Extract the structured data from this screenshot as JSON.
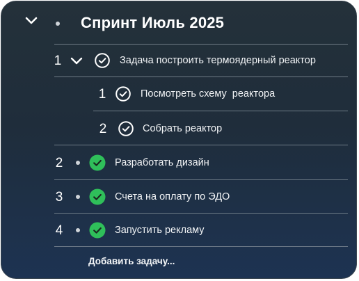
{
  "title": "Спринт Июль 2025",
  "tasks": [
    {
      "number": "1",
      "label": "Задача построить термоядерный реактор",
      "status": "outline",
      "subtasks": [
        {
          "number": "1",
          "label": "Посмотреть схему  реактора",
          "status": "outline"
        },
        {
          "number": "2",
          "label": "Собрать реактор",
          "status": "outline"
        }
      ]
    },
    {
      "number": "2",
      "label": "Разработать дизайн",
      "status": "done"
    },
    {
      "number": "3",
      "label": "Счета на оплату по ЭДО",
      "status": "done"
    },
    {
      "number": "4",
      "label": "Запустить рекламу",
      "status": "done"
    }
  ],
  "add_task_label": "Добавить задачу...",
  "colors": {
    "done": "#2fbf5a",
    "panel_top": "#24313a",
    "panel_bottom": "#1d3352"
  }
}
